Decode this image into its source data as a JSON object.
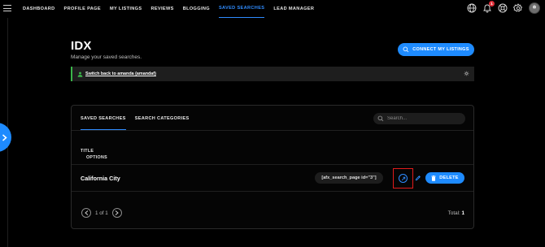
{
  "nav": {
    "links": [
      {
        "label": "DASHBOARD"
      },
      {
        "label": "PROFILE PAGE"
      },
      {
        "label": "MY LISTINGS"
      },
      {
        "label": "REVIEWS"
      },
      {
        "label": "BLOGGING"
      },
      {
        "label": "SAVED SEARCHES"
      },
      {
        "label": "LEAD MANAGER"
      }
    ],
    "active": "SAVED SEARCHES",
    "notification_count": "1",
    "icons": [
      "globe-icon",
      "bell-icon",
      "support-icon",
      "gear-icon",
      "avatar"
    ]
  },
  "header": {
    "title": "IDX",
    "subtitle": "Manage your saved searches.",
    "connect_label": "CONNECT MY LISTINGS"
  },
  "notice": {
    "text": "Switch back to amanda (amandaf)"
  },
  "tabs": [
    {
      "label": "SAVED SEARCHES",
      "active": true
    },
    {
      "label": "SEARCH CATEGORIES",
      "active": false
    }
  ],
  "search": {
    "placeholder": "Search..."
  },
  "table": {
    "col_title": "TITLE",
    "col_options": "OPTIONS",
    "rows": [
      {
        "title": "California City",
        "shortcode": "[afx_search_page id=\"3\"]",
        "delete_label": "DELETE"
      }
    ]
  },
  "pagination": {
    "page_text": "1 of 1",
    "total_label": "Total:",
    "total_value": "1"
  },
  "colors": {
    "accent": "#1e8bff",
    "highlight_box": "#e11b1b",
    "notice_bar": "#3bb54a",
    "badge": "#e0303a"
  }
}
